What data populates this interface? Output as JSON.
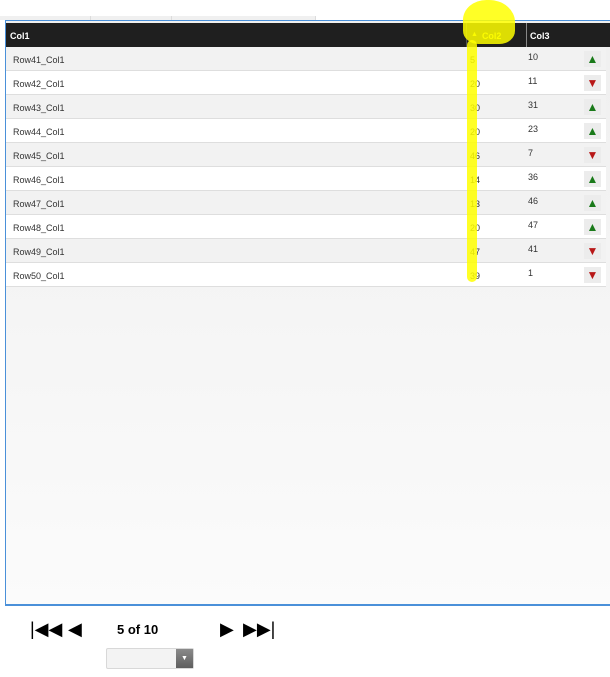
{
  "grid": {
    "columns": [
      {
        "label": "Col1"
      },
      {
        "label": "Col2",
        "sorted": "ascending",
        "sort_icon": "sort-ascending-icon"
      },
      {
        "label": "Col3"
      }
    ],
    "rows": [
      {
        "col1": "Row41_Col1",
        "col2": "5",
        "col3": "10",
        "trend": "up",
        "trend_glyph": "▲"
      },
      {
        "col1": "Row42_Col1",
        "col2": "20",
        "col3": "11",
        "trend": "down",
        "trend_glyph": "▼"
      },
      {
        "col1": "Row43_Col1",
        "col2": "30",
        "col3": "31",
        "trend": "up",
        "trend_glyph": "▲"
      },
      {
        "col1": "Row44_Col1",
        "col2": "20",
        "col3": "23",
        "trend": "up",
        "trend_glyph": "▲"
      },
      {
        "col1": "Row45_Col1",
        "col2": "46",
        "col3": "7",
        "trend": "down",
        "trend_glyph": "▼"
      },
      {
        "col1": "Row46_Col1",
        "col2": "14",
        "col3": "36",
        "trend": "up",
        "trend_glyph": "▲"
      },
      {
        "col1": "Row47_Col1",
        "col2": "13",
        "col3": "46",
        "trend": "up",
        "trend_glyph": "▲"
      },
      {
        "col1": "Row48_Col1",
        "col2": "20",
        "col3": "47",
        "trend": "up",
        "trend_glyph": "▲"
      },
      {
        "col1": "Row49_Col1",
        "col2": "47",
        "col3": "41",
        "trend": "down",
        "trend_glyph": "▼"
      },
      {
        "col1": "Row50_Col1",
        "col2": "39",
        "col3": "1",
        "trend": "down",
        "trend_glyph": "▼"
      }
    ]
  },
  "pager": {
    "first_glyph": "|◀◀",
    "prev_glyph": "◀",
    "next_glyph": "▶",
    "last_glyph": "▶▶|",
    "page_info": "5 of 10",
    "current_page": 5,
    "total_pages": 10
  },
  "page_size_select": {
    "value": "",
    "arrow_glyph": "▼"
  },
  "colors": {
    "header_bg": "#1f1f1f",
    "sorted_header_text": "#e8e800",
    "trend_up": "#1a7a1a",
    "trend_down": "#b81818",
    "annotation_highlight": "#ffff00",
    "grid_border": "#4a90d9"
  }
}
